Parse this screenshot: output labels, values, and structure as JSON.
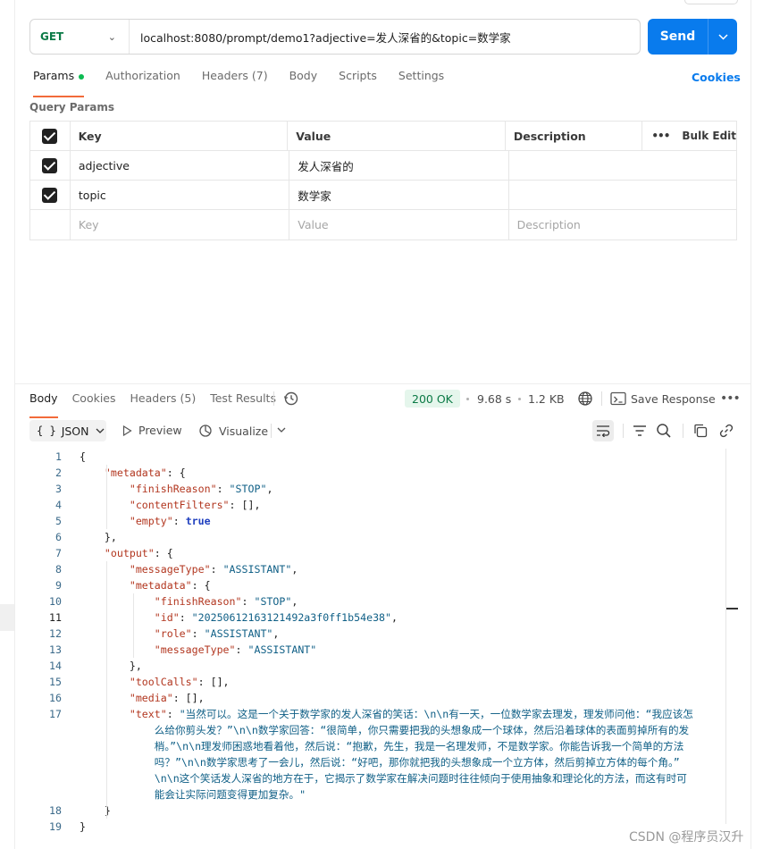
{
  "request": {
    "method": "GET",
    "url": "localhost:8080/prompt/demo1?adjective=发人深省的&topic=数学家",
    "send_label": "Send"
  },
  "request_tabs": [
    {
      "label": "Params",
      "active": true
    },
    {
      "label": "Authorization"
    },
    {
      "label": "Headers (7)"
    },
    {
      "label": "Body"
    },
    {
      "label": "Scripts"
    },
    {
      "label": "Settings"
    }
  ],
  "cookies_label": "Cookies",
  "query_params": {
    "title": "Query Params",
    "headers": {
      "key": "Key",
      "value": "Value",
      "description": "Description",
      "bulk_edit": "Bulk Edit"
    },
    "rows": [
      {
        "key": "adjective",
        "value": "发人深省的",
        "description": "",
        "checked": true
      },
      {
        "key": "topic",
        "value": "数学家",
        "description": "",
        "checked": true
      }
    ],
    "placeholders": {
      "key": "Key",
      "value": "Value",
      "description": "Description"
    }
  },
  "response_tabs": [
    {
      "label": "Body",
      "active": true
    },
    {
      "label": "Cookies"
    },
    {
      "label": "Headers (5)"
    },
    {
      "label": "Test Results"
    }
  ],
  "response_meta": {
    "status": "200 OK",
    "time": "9.68 s",
    "size": "1.2 KB",
    "save_label": "Save Response"
  },
  "response_toolbar": {
    "format": "JSON",
    "preview": "Preview",
    "visualize": "Visualize"
  },
  "code_lines": [
    {
      "n": "1",
      "html": "{"
    },
    {
      "n": "2",
      "html": "    <span class='k'>\"metadata\"</span>: {"
    },
    {
      "n": "3",
      "html": "        <span class='k'>\"finishReason\"</span>: <span class='s'>\"STOP\"</span>,"
    },
    {
      "n": "4",
      "html": "        <span class='k'>\"contentFilters\"</span>: [],"
    },
    {
      "n": "5",
      "html": "        <span class='k'>\"empty\"</span>: <span class='b'>true</span>"
    },
    {
      "n": "6",
      "html": "    },"
    },
    {
      "n": "7",
      "html": "    <span class='k'>\"output\"</span>: {"
    },
    {
      "n": "8",
      "html": "        <span class='k'>\"messageType\"</span>: <span class='s'>\"ASSISTANT\"</span>,"
    },
    {
      "n": "9",
      "html": "        <span class='k'>\"metadata\"</span>: {"
    },
    {
      "n": "10",
      "html": "            <span class='k'>\"finishReason\"</span>: <span class='s'>\"STOP\"</span>,"
    },
    {
      "n": "11",
      "html": "            <span class='k'>\"id\"</span>: <span class='s'>\"20250612163121492a3f0ff1b54e38\"</span>,",
      "current": true
    },
    {
      "n": "12",
      "html": "            <span class='k'>\"role\"</span>: <span class='s'>\"ASSISTANT\"</span>,"
    },
    {
      "n": "13",
      "html": "            <span class='k'>\"messageType\"</span>: <span class='s'>\"ASSISTANT\"</span>"
    },
    {
      "n": "14",
      "html": "        },"
    },
    {
      "n": "15",
      "html": "        <span class='k'>\"toolCalls\"</span>: [],"
    },
    {
      "n": "16",
      "html": "        <span class='k'>\"media\"</span>: [],"
    },
    {
      "n": "17",
      "key": "\"text\"",
      "value_lines": [
        "\"当然可以。这是一个关于数学家的发人深省的笑话：\\n\\n有一天，一位数学家去理发，理发师问他：“我应该怎",
        "么给你剪头发？”\\n\\n数学家回答：“很简单，你只需要把我的头想象成一个球体，然后沿着球体的表面剪掉所有的发",
        "梢。”\\n\\n理发师困惑地看着他，然后说：“抱歉，先生，我是一名理发师，不是数学家。你能告诉我一个简单的方法",
        "吗？”\\n\\n数学家思考了一会儿，然后说：“好吧，那你就把我的头想象成一个立方体，然后剪掉立方体的每个角。”",
        "\\n\\n这个笑话发人深省的地方在于，它揭示了数学家在解决问题时往往倾向于使用抽象和理论化的方法，而这有时可",
        "能会让实际问题变得更加复杂。\""
      ]
    },
    {
      "n": "18",
      "html": "    }"
    },
    {
      "n": "19",
      "html": "}"
    }
  ],
  "watermark": "CSDN @程序员汉升"
}
